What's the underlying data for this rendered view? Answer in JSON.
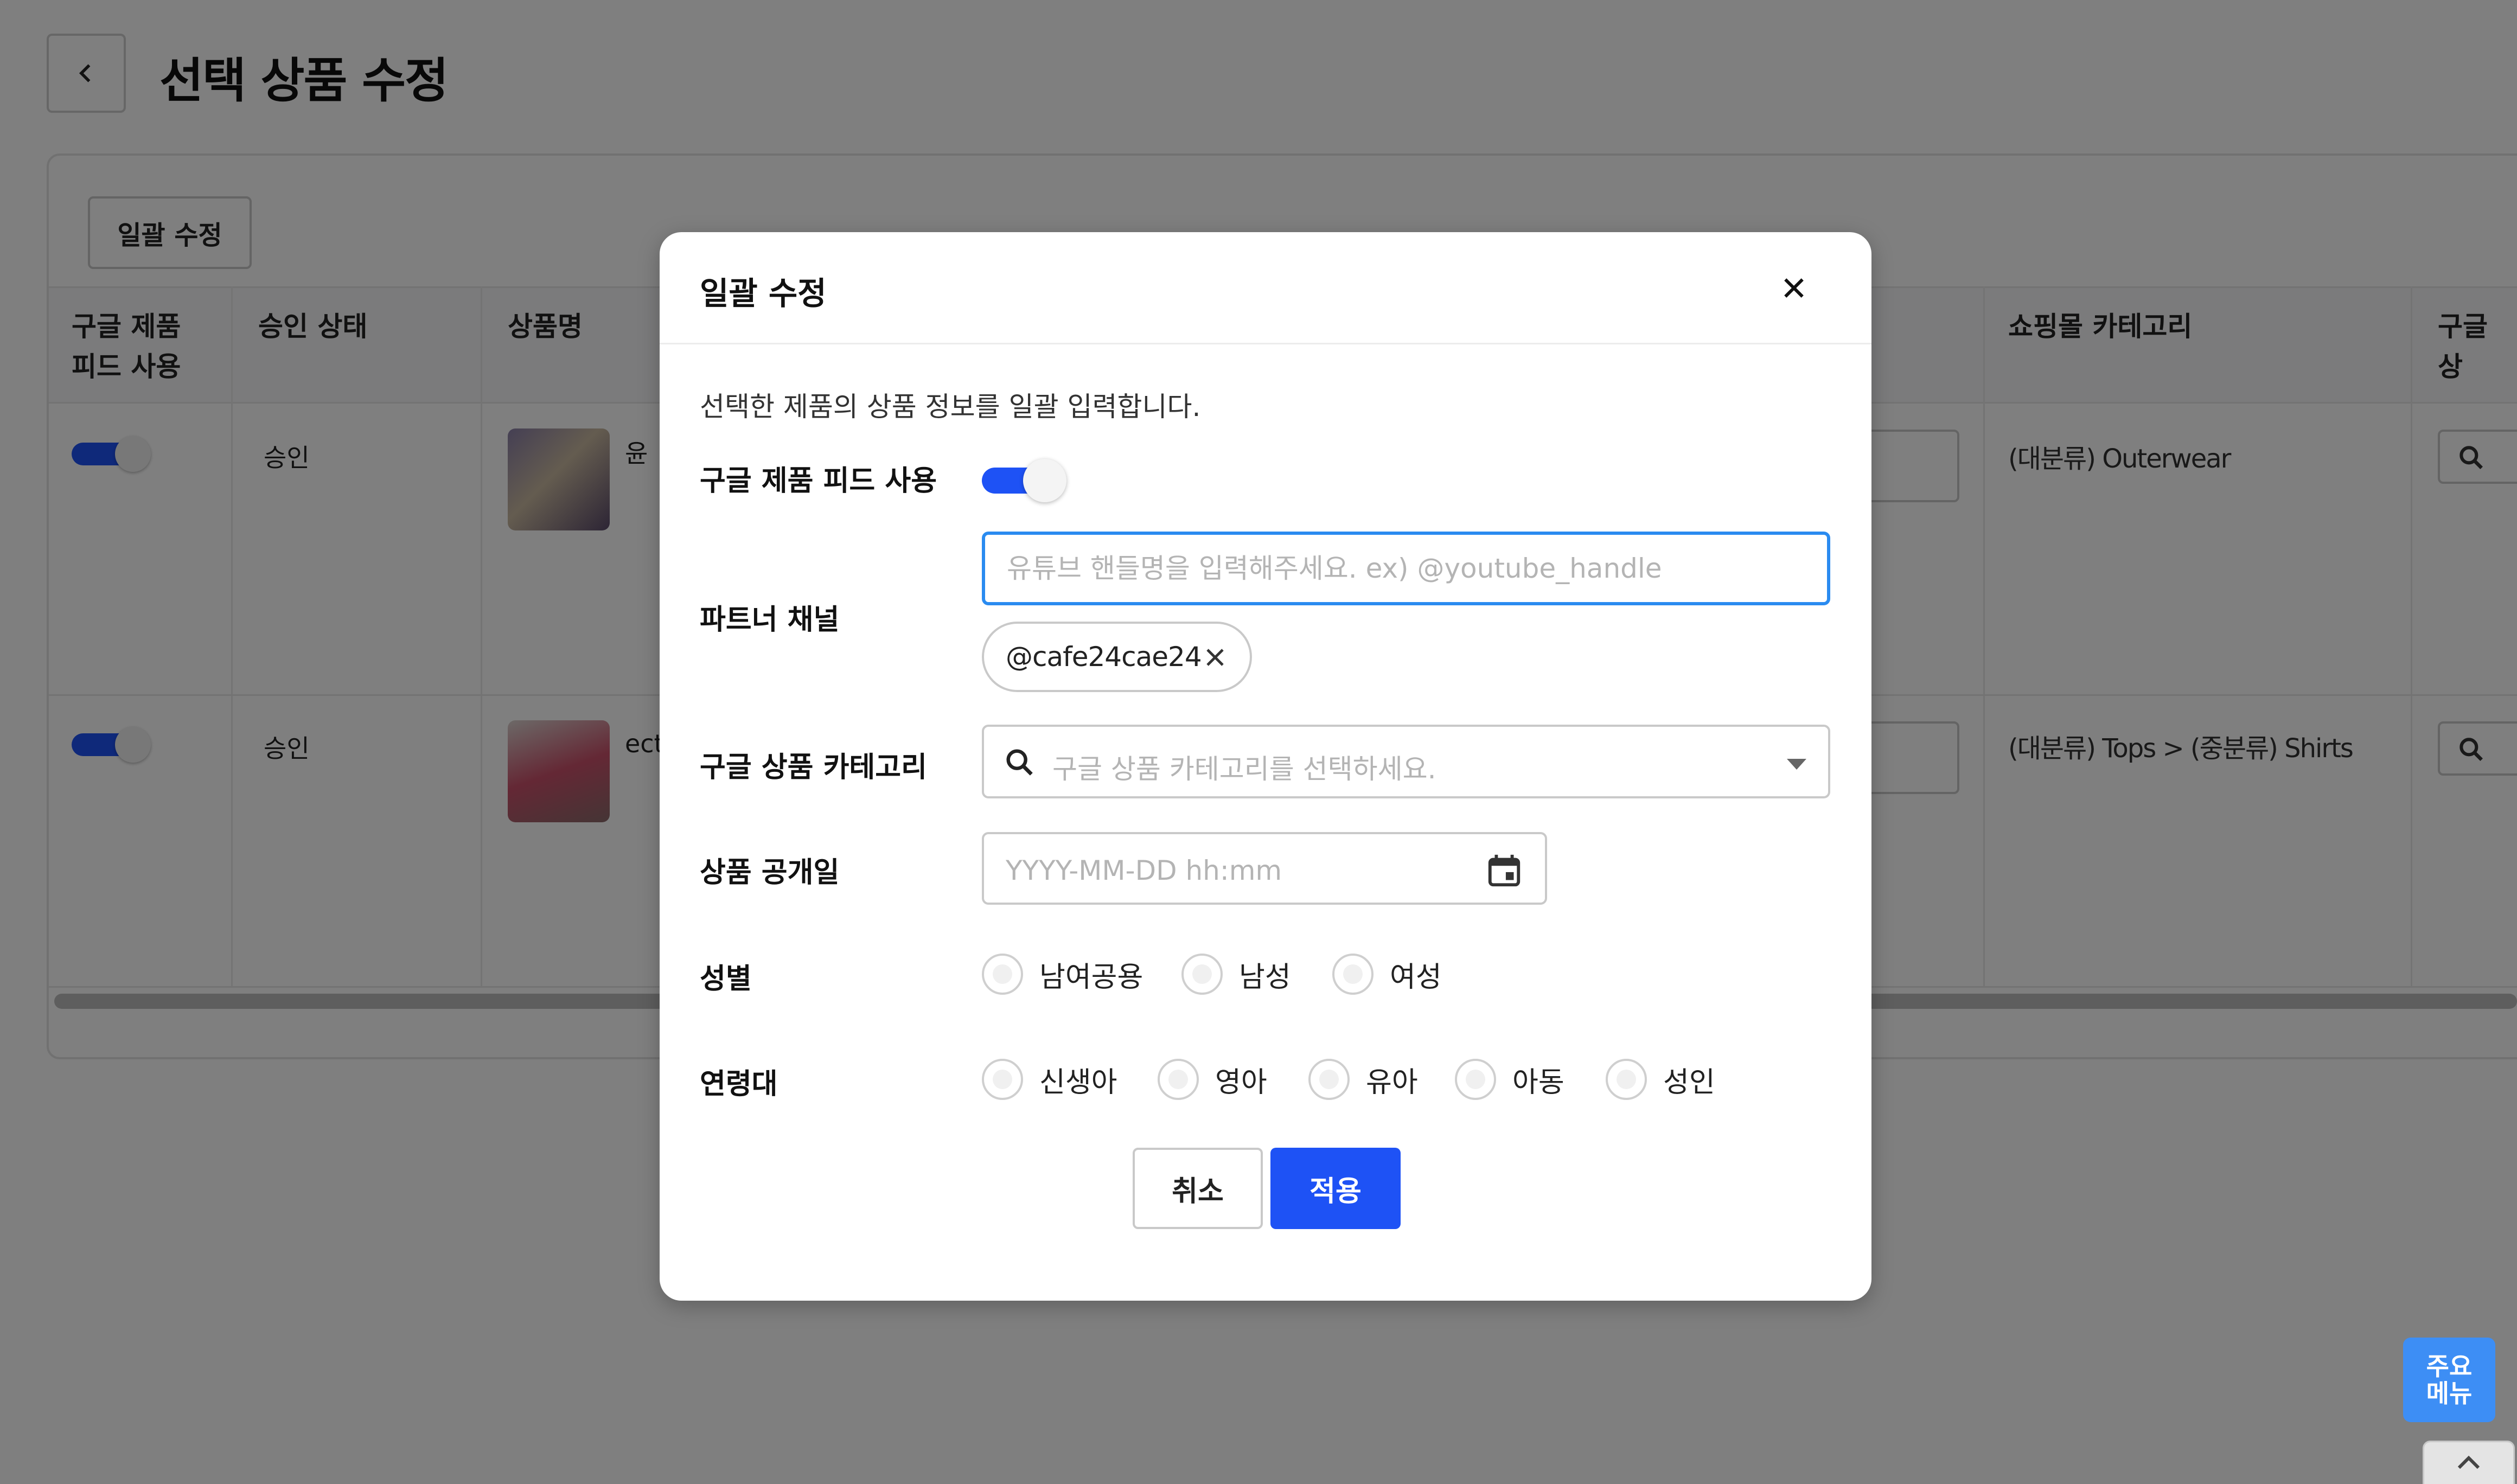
{
  "page": {
    "title": "선택 상품 수정",
    "bulk_edit_button": "일괄 수정",
    "table": {
      "headers": [
        "구글 제품\n피드 사용",
        "승인 상태",
        "상품명",
        "쇼핑몰 카테고리",
        "구글 상"
      ],
      "rows": [
        {
          "approval": "승인",
          "name": "윤",
          "category": "(대분류) Outerwear"
        },
        {
          "approval": "승인",
          "name": "ect",
          "category": "(대분류) Tops > (중분류) Shirts"
        }
      ]
    }
  },
  "modal": {
    "title": "일괄 수정",
    "description": "선택한 제품의 상품 정보를 일괄 입력합니다.",
    "feed_label": "구글 제품 피드 사용",
    "partner_label": "파트너 채널",
    "partner_placeholder": "유튜브 핸들명을 입력해주세요. ex) @youtube_handle",
    "partner_chip": "@cafe24cae24",
    "category_label": "구글 상품 카테고리",
    "category_placeholder": "구글 상품 카테고리를 선택하세요.",
    "release_label": "상품 공개일",
    "release_placeholder": "YYYY-MM-DD hh:mm",
    "gender_label": "성별",
    "gender_options": [
      "남여공용",
      "남성",
      "여성"
    ],
    "age_label": "연령대",
    "age_options": [
      "신생아",
      "영아",
      "유아",
      "아동",
      "성인"
    ],
    "cancel": "취소",
    "apply": "적용"
  },
  "floating": {
    "main_menu_line1": "주요",
    "main_menu_line2": "메뉴"
  },
  "colors": {
    "accent": "#1e52f5",
    "focus": "#2a8bf0",
    "menu": "#3d8ef5",
    "overlay": "rgba(0,0,0,0.5)"
  }
}
